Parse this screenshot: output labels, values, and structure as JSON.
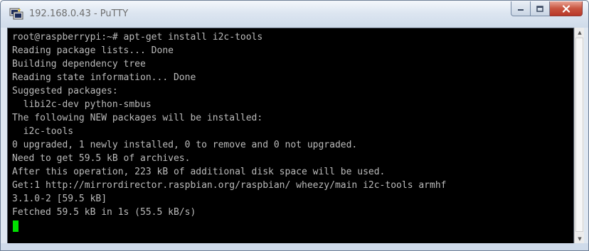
{
  "window": {
    "title": "192.168.0.43 - PuTTY",
    "icon": "putty-terminal-icon"
  },
  "controls": {
    "minimize_icon": "minimize-icon",
    "maximize_icon": "maximize-icon",
    "close_icon": "close-icon"
  },
  "terminal": {
    "background": "#000000",
    "text_color": "#bbbbbb",
    "cursor_color": "#00e000",
    "lines": [
      "root@raspberrypi:~# apt-get install i2c-tools",
      "Reading package lists... Done",
      "Building dependency tree",
      "Reading state information... Done",
      "Suggested packages:",
      "  libi2c-dev python-smbus",
      "The following NEW packages will be installed:",
      "  i2c-tools",
      "0 upgraded, 1 newly installed, 0 to remove and 0 not upgraded.",
      "Need to get 59.5 kB of archives.",
      "After this operation, 223 kB of additional disk space will be used.",
      "Get:1 http://mirrordirector.raspbian.org/raspbian/ wheezy/main i2c-tools armhf",
      "3.1.0-2 [59.5 kB]",
      "Fetched 59.5 kB in 1s (55.5 kB/s)"
    ]
  }
}
